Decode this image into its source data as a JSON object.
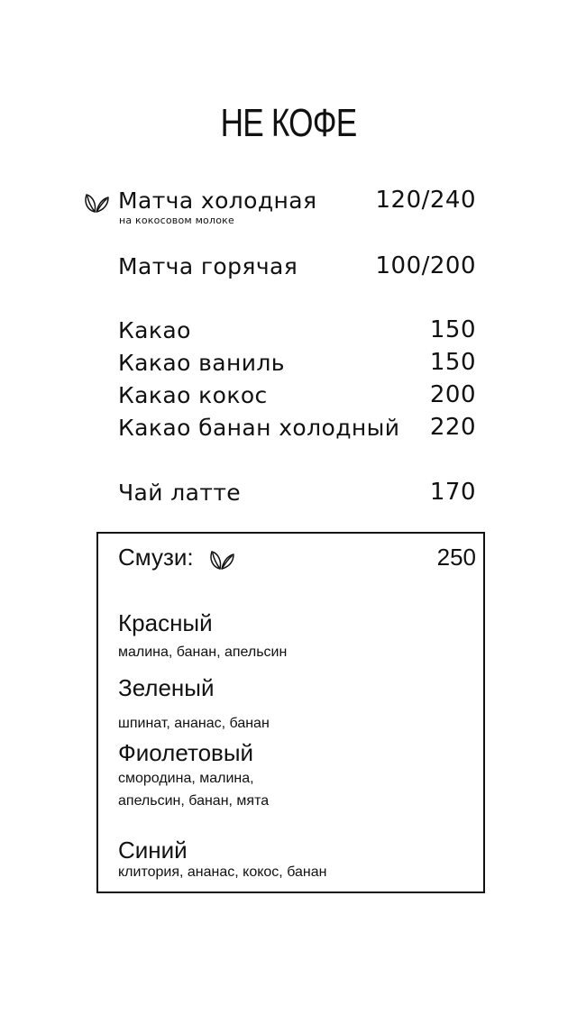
{
  "menu": {
    "title": "НЕ КОФЕ",
    "items": [
      {
        "name": "Матча холодная",
        "subtitle": "на кокосовом молоке",
        "price": "120/240",
        "icon": "leaf-icon"
      },
      {
        "name": "Матча горячая",
        "price": "100/200"
      },
      {
        "name": "Какао",
        "price": "150"
      },
      {
        "name": "Какао ваниль",
        "price": "150"
      },
      {
        "name": "Какао кокос",
        "price": "200"
      },
      {
        "name": "Какао банан холодный",
        "price": "220"
      },
      {
        "name": "Чай латте",
        "price": "170"
      }
    ],
    "smoothie": {
      "label": "Смузи:",
      "icon": "leaf-icon",
      "price": "250",
      "items": [
        {
          "name": "Красный",
          "description": [
            "малина, банан, апельсин"
          ]
        },
        {
          "name": "Зеленый",
          "description": [
            "шпинат, ананас, банан"
          ]
        },
        {
          "name": "Фиолетовый",
          "description": [
            "смородина, малина,",
            "апельсин, банан, мята"
          ]
        },
        {
          "name": "Синий",
          "description": [
            "клитория, ананас, кокос, банан"
          ]
        }
      ]
    }
  }
}
